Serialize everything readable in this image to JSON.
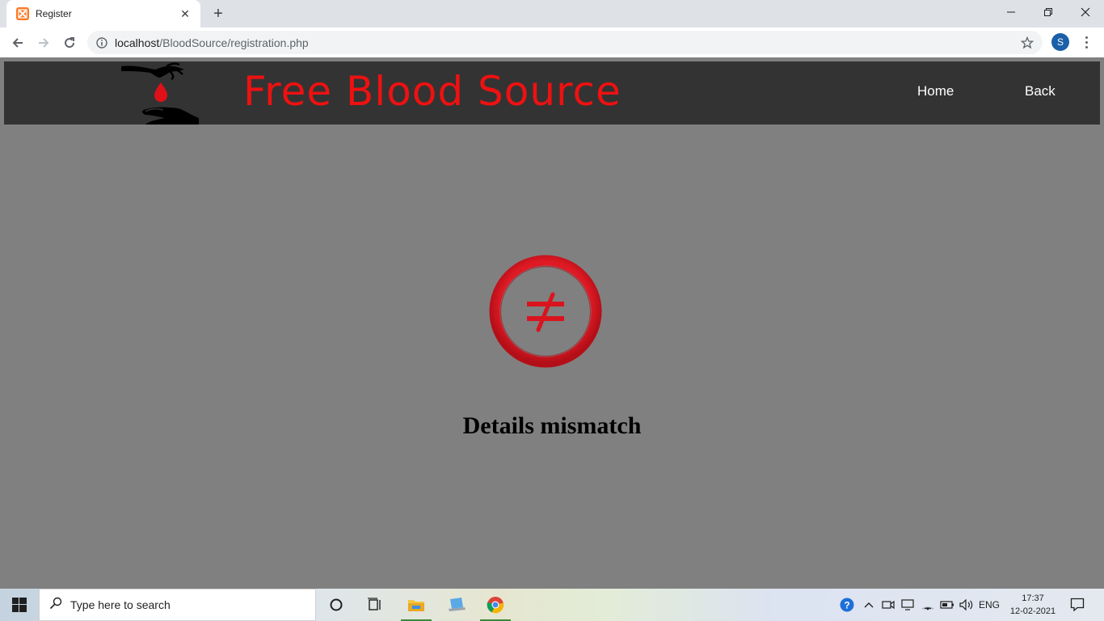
{
  "browser": {
    "tab_title": "Register",
    "url_host": "localhost",
    "url_path": "/BloodSource/registration.php",
    "profile_initial": "S"
  },
  "site": {
    "title": "Free Blood Source",
    "nav": [
      {
        "label": "Home"
      },
      {
        "label": "Back"
      }
    ],
    "title_color": "#ee1111",
    "header_bg": "#333333",
    "page_bg": "#808080"
  },
  "message": {
    "text": "Details mismatch",
    "icon": "not-equal-icon",
    "icon_color": "#d9141e"
  },
  "taskbar": {
    "search_placeholder": "Type here to search",
    "language": "ENG",
    "time": "17:37",
    "date": "12-02-2021"
  }
}
